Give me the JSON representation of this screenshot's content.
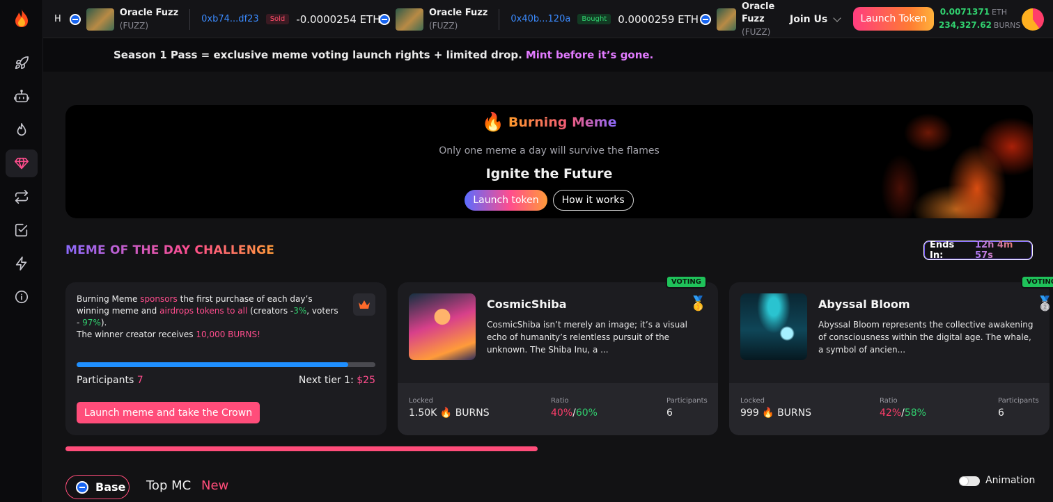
{
  "ticker": [
    {
      "name": "Oracle Fuzz",
      "symbol": "(FUZZ)",
      "address": "0xb74...df23",
      "action": "Sold",
      "amount": "-0.0000254 ETH"
    },
    {
      "name": "Oracle Fuzz",
      "symbol": "(FUZZ)",
      "address": "0x40b...120a",
      "action": "Bought",
      "amount": "0.0000259 ETH"
    },
    {
      "name": "Oracle Fuzz",
      "symbol": "(FUZZ)"
    }
  ],
  "header": {
    "join_label": "Join Us",
    "launch_label": "Launch Token",
    "eth_balance": "0.0071371",
    "eth_unit": "ETH",
    "burns_balance": "234,327.62",
    "burns_unit": "BURNS"
  },
  "announcement": {
    "text": "Season 1 Pass = exclusive meme voting launch rights + limited drop.",
    "cta": "Mint before it’s gone."
  },
  "hero": {
    "brand": "Burning Meme",
    "subtitle": "Only one meme a day will survive the flames",
    "headline": "Ignite the Future",
    "launch_btn": "Launch token",
    "how_btn": "How it works"
  },
  "challenge": {
    "title": "MEME OF THE DAY CHALLENGE",
    "ends_label": "Ends In:",
    "ends_value": "12h 4m 57s",
    "sponsor": {
      "p1": "Burning Meme",
      "p2": "sponsors",
      "p3": "the first purchase of each day’s winning meme and",
      "p4": "airdrops tokens to all",
      "p5": "(creators -",
      "p6": "3%",
      "p7": ", voters -",
      "p8": "97%",
      "p9": ").",
      "p10": "The winner creator receives",
      "p11": "10,000 BURNS!"
    },
    "progress": 0.91,
    "participants_label": "Participants",
    "participants_value": "7",
    "next_tier_label": "Next tier 1:",
    "next_tier_value": "$25",
    "crown_btn": "Launch meme and take the Crown"
  },
  "memes": [
    {
      "badge": "VOTING",
      "name": "CosmicShiba",
      "medal": "🥇",
      "desc": "CosmicShiba isn’t merely an image; it’s a visual echo of humanity’s relentless pursuit of the unknown. The Shiba Inu, a ...",
      "locked_label": "Locked",
      "locked_value": "1.50K",
      "locked_unit": "BURNS",
      "ratio_label": "Ratio",
      "ratio_red": "40%",
      "ratio_green": "60%",
      "participants_label": "Participants",
      "participants_value": "6"
    },
    {
      "badge": "VOTING",
      "name": "Abyssal Bloom",
      "medal": "🥈",
      "desc": "Abyssal Bloom represents the collective awakening of consciousness within the digital age. The whale, a symbol of ancien...",
      "locked_label": "Locked",
      "locked_value": "999",
      "locked_unit": "BURNS",
      "ratio_label": "Ratio",
      "ratio_red": "42%",
      "ratio_green": "58%",
      "participants_label": "Participants",
      "participants_value": "6"
    }
  ],
  "tabs": {
    "chain": "Base",
    "top_mc": "Top MC",
    "new": "New",
    "animation": "Animation"
  },
  "sidebar": [
    "rocket-icon",
    "robot-icon",
    "flame-icon",
    "diamond-icon",
    "swap-icon",
    "checklist-icon",
    "bolt-icon",
    "info-icon"
  ]
}
